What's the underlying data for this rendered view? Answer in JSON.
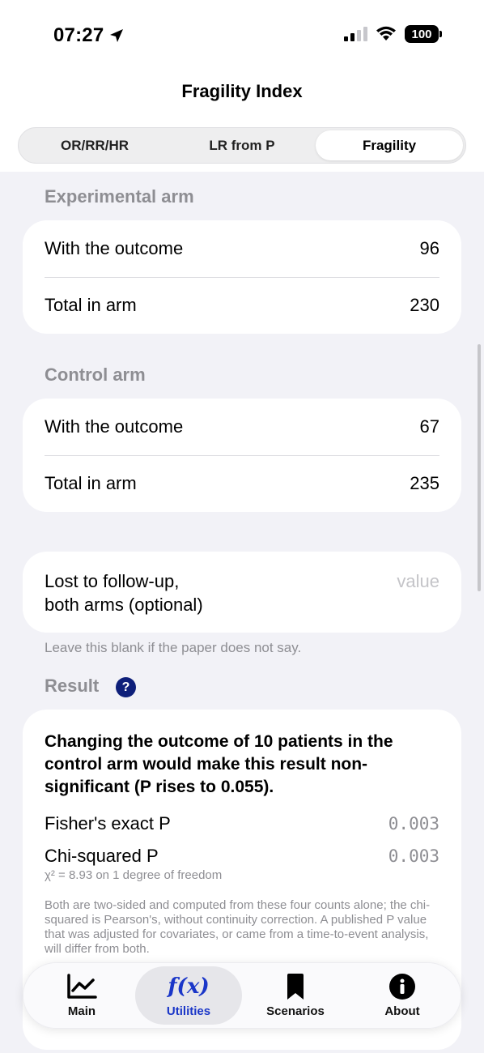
{
  "status_bar": {
    "time": "07:27",
    "battery": "100"
  },
  "nav": {
    "title": "Fragility Index"
  },
  "segments": [
    {
      "label": "OR/RR/HR"
    },
    {
      "label": "LR from P"
    },
    {
      "label": "Fragility",
      "selected": true
    }
  ],
  "experimental_arm": {
    "header": "Experimental arm",
    "rows": [
      {
        "label": "With the outcome",
        "value": "96"
      },
      {
        "label": "Total in arm",
        "value": "230"
      }
    ]
  },
  "control_arm": {
    "header": "Control arm",
    "rows": [
      {
        "label": "With the outcome",
        "value": "67"
      },
      {
        "label": "Total in arm",
        "value": "235"
      }
    ]
  },
  "lost_to_followup": {
    "label_line1": "Lost to follow-up,",
    "label_line2": "both arms (optional)",
    "placeholder": "value",
    "footnote": "Leave this blank if the paper does not say."
  },
  "result": {
    "header": "Result",
    "help": "?",
    "headline": "Changing the outcome of 10 patients in the control arm would make this result non-significant (P rises to 0.055).",
    "fisher_label": "Fisher's exact P",
    "fisher_value": "0.003",
    "chi_label": "Chi-squared P",
    "chi_value": "0.003",
    "chi_sub": "χ² = 8.93 on 1 degree of freedom",
    "note": "Both are two-sided and computed from these four counts alone; the chi-squared is Pearson's, without continuity correction. A published P value that was adjusted for covariates, or came from a time-to-event analysis, will differ from both."
  },
  "tabbar": {
    "tabs": [
      {
        "label": "Main",
        "icon": "chart-icon"
      },
      {
        "label": "Utilities",
        "icon": "function-icon",
        "glyph": "f(x)",
        "selected": true
      },
      {
        "label": "Scenarios",
        "icon": "bookmark-icon"
      },
      {
        "label": "About",
        "icon": "info-icon"
      }
    ]
  },
  "colors": {
    "accent": "#1a36c8",
    "help_badge": "#0e1f7a",
    "secondary_text": "#8e8e93",
    "background": "#f2f2f7"
  }
}
